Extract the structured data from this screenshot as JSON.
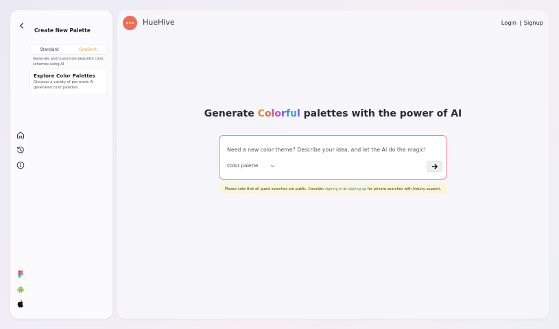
{
  "sidebar": {
    "create": {
      "title": "Create New Palette",
      "tabs": [
        {
          "label": "Standard",
          "active": false
        },
        {
          "label": "Gradient",
          "active": true
        }
      ],
      "description": "Generate and customize beautiful color schemes using AI"
    },
    "explore": {
      "title": "Explore Color Palettes",
      "description": "Discover a variety of pre-made AI generated color palettes."
    },
    "nav_icons": [
      "home-icon",
      "history-icon",
      "info-icon"
    ],
    "platform_icons": [
      "figma-icon",
      "android-icon",
      "apple-icon"
    ]
  },
  "header": {
    "brand": "HueHive",
    "login": "Login",
    "separator": "|",
    "signup": "Signup"
  },
  "hero": {
    "prefix": "Generate ",
    "colorful_letters": [
      "C",
      "o",
      "l",
      "o",
      "r",
      "f",
      "u",
      "l"
    ],
    "colorful_colors": [
      "#f08a24",
      "#f06a3a",
      "#e84a8a",
      "#c34fd6",
      "#7a55e6",
      "#3f8fe8",
      "#2bb0c8",
      "#7a55e6"
    ],
    "suffix": " palettes with the power of AI"
  },
  "prompt": {
    "placeholder": "Need a new color theme? Describe your idea, and let the AI do the magic!",
    "selected_option": "Color palette",
    "accent": "#ef7a86"
  },
  "notice": {
    "text_before": "Please note that all guest searches are public. Consider",
    "signin_link": "signing in",
    "text_middle": "or",
    "signup_link": "signing up",
    "text_after": "for private searches with history support."
  },
  "colors": {
    "logo_bg": "#ef6b5e",
    "logo_dots": "#ffd66a",
    "gradient_tab": "#f0a040",
    "link": "#3b78c6"
  }
}
